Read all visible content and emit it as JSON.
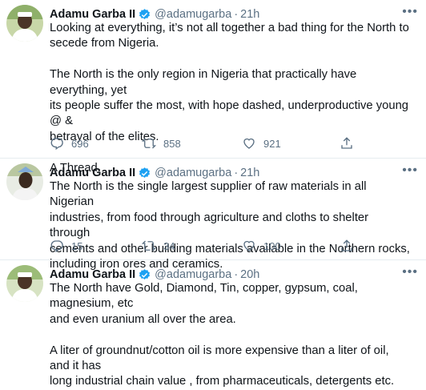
{
  "colors": {
    "verified": "#1da1f2",
    "muted": "#5b7083",
    "text": "#0f1419",
    "divider": "#e6ecf0"
  },
  "tweets": [
    {
      "name": "Adamu Garba II",
      "handle": "@adamugarba",
      "dot": "·",
      "time": "21h",
      "text": "Looking at everything, it’s not all together a bad thing for the North to\nsecede from Nigeria.\n\nThe North is the only region in Nigeria that practically have everything, yet\nits people suffer the most, with hope dashed, underproductive young @ &\nbetrayal of the elites.\n\nA Thread.",
      "replies": "696",
      "retweets": "858",
      "likes": "921"
    },
    {
      "name": "Adamu Garba II",
      "handle": "@adamugarba",
      "dot": "·",
      "time": "21h",
      "text": "The North is the single largest supplier of raw materials in all Nigerian\nindustries, from food through agriculture and cloths to shelter through\ncements and other building materials available in the Northern rocks,\nincluding iron ores and ceramics.",
      "replies": "15",
      "retweets": "34",
      "likes": "100"
    },
    {
      "name": "Adamu Garba II",
      "handle": "@adamugarba",
      "dot": "·",
      "time": "20h",
      "text": "The North have Gold, Diamond, Tin, copper, gypsum, coal, magnesium, etc\nand even uranium all over the area.\n\nA liter of groundnut/cotton oil is more expensive than a liter of oil, and it has\nlong industrial chain value , from pharmaceuticals, detergents etc."
    }
  ],
  "icons": {
    "verified": "verified-badge-icon",
    "more": "more-options-icon",
    "reply": "reply-icon",
    "retweet": "retweet-icon",
    "like": "like-icon",
    "share": "share-icon"
  }
}
